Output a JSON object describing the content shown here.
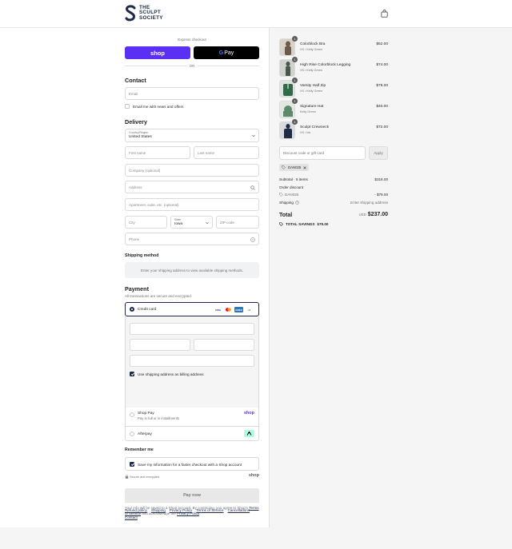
{
  "header": {
    "brand_line1": "THE",
    "brand_line2": "SCULPT",
    "brand_line3": "SOCIETY",
    "cart_icon": "shopping-bag-icon"
  },
  "express": {
    "label": "Express checkout",
    "shop_label": "shop",
    "gpay_g": "G",
    "gpay_label": "Pay",
    "or": "OR"
  },
  "contact": {
    "heading": "Contact",
    "email_placeholder": "Email",
    "newsletter_label": "Email me with news and offers"
  },
  "delivery": {
    "heading": "Delivery",
    "country_label": "Country/Region",
    "country_value": "United States",
    "first_name": "First name",
    "last_name": "Last name",
    "company": "Company (optional)",
    "address": "Address",
    "apartment": "Apartment, suite, etc. (optional)",
    "city": "City",
    "state_label": "State",
    "state_value": "Iowa",
    "zip": "ZIP code",
    "phone": "Phone"
  },
  "shipping": {
    "heading": "Shipping method",
    "message": "Enter your shipping address to view available shipping methods."
  },
  "payment": {
    "heading": "Payment",
    "caption": "All transactions are secure and encrypted.",
    "credit_card_label": "Credit card",
    "card_brands": [
      "VISA",
      "",
      "AMEX",
      "+5"
    ],
    "billing_label": "Use shipping address as billing address",
    "shop_pay_label": "Shop Pay",
    "shop_pay_sub": "Pay in full or in installments",
    "shop_pay_logo": "shop",
    "afterpay_label": "Afterpay"
  },
  "remember": {
    "heading": "Remember me",
    "save_label": "Save my information for a faster checkout with a Shop account",
    "secure_label": "Secure and encrypted",
    "shop_logo": "shop"
  },
  "pay_button": "Pay now",
  "legal": {
    "text1": "Your info will be saved to a Shop account. By continuing, you agree to Shop's",
    "terms_link": "Terms of Service",
    "text2": "and acknowledge the",
    "privacy_link": "Privacy Policy",
    "text3": "."
  },
  "footer_links": [
    "Refund policy",
    "Shipping",
    "Privacy Policy",
    "Terms of Service",
    "Cancellations",
    "Contact"
  ],
  "cart": {
    "items": [
      {
        "name": "Colorblock Bra",
        "variant": "XS / Kelly Green",
        "price": "$52.00",
        "qty": "1",
        "color": "#6b5a4c"
      },
      {
        "name": "High Rise Colorblock Legging",
        "variant": "XS / Kelly Green",
        "price": "$74.00",
        "qty": "1",
        "color": "#49574a"
      },
      {
        "name": "Varsity Half Zip",
        "variant": "XS / Kelly Green",
        "price": "$78.00",
        "qty": "1",
        "color": "#2f6b47"
      },
      {
        "name": "Signature Hat",
        "variant": "Kelly Green",
        "price": "$40.00",
        "qty": "1",
        "color": "#5e8a6c"
      },
      {
        "name": "Sculpt Crewneck",
        "variant": "XS / Ink",
        "price": "$72.00",
        "qty": "1",
        "color": "#1f2a44"
      }
    ],
    "discount_placeholder": "Discount code or gift card",
    "apply_label": "Apply",
    "applied_code": "DAN025",
    "subtotal_label": "Subtotal · 5 items",
    "subtotal_value": "$316.00",
    "order_discount_label": "Order discount",
    "discount_code": "DAN025",
    "discount_value": "- $79.00",
    "shipping_label": "Shipping",
    "shipping_value": "Enter shipping address",
    "total_label": "Total",
    "total_currency": "USD",
    "total_value": "$237.00",
    "savings_label": "TOTAL SAVINGS",
    "savings_value": "$79.00"
  },
  "colors": {
    "shop_purple": "#5a31f4",
    "brand_navy": "#1b2a4a",
    "border": "#d9d9d9"
  }
}
